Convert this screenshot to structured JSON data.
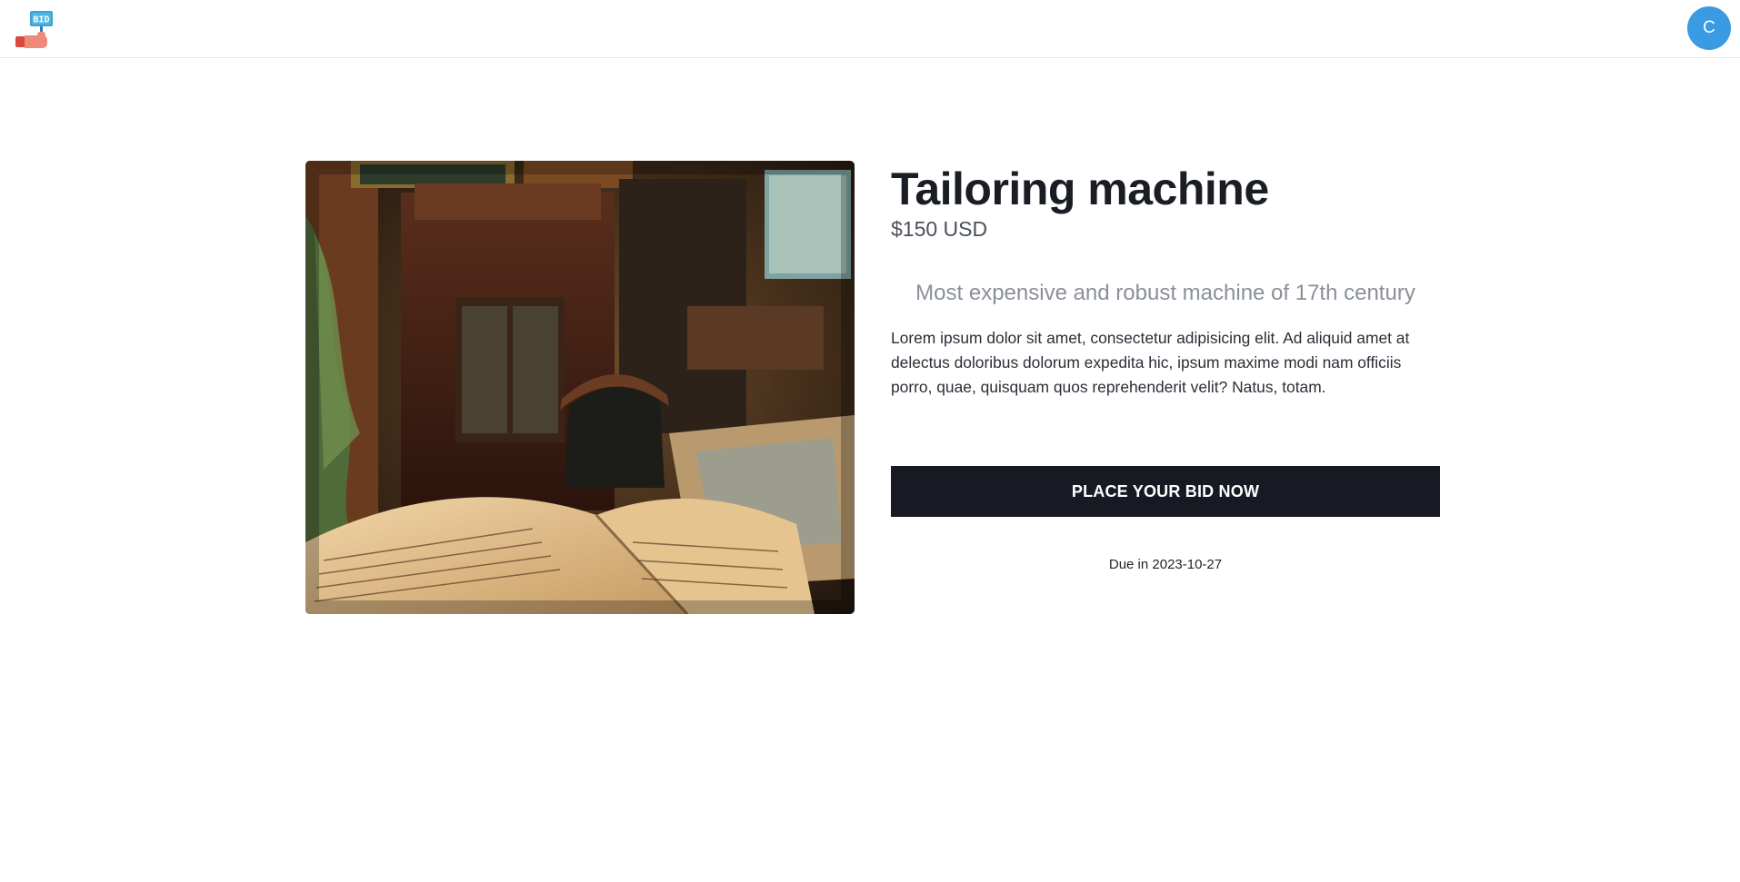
{
  "header": {
    "logo_text": "BID",
    "avatar_initial": "C"
  },
  "item": {
    "title": "Tailoring machine",
    "price": "$150 USD",
    "subtitle": "Most expensive and robust machine of 17th century",
    "description": "Lorem ipsum dolor sit amet, consectetur adipisicing elit. Ad aliquid amet at delectus doloribus dolorum expedita hic, ipsum maxime modi nam officiis porro, quae, quisquam quos reprehenderit velit? Natus, totam.",
    "bid_label": "PLACE YOUR BID NOW",
    "due": "Due in 2023-10-27"
  },
  "colors": {
    "avatar": "#3a9be3",
    "button": "#171a22",
    "logo_sign": "#3aa3d6",
    "logo_hand": "#e06a55"
  },
  "icons": {
    "logo": "bid-hand-icon"
  }
}
